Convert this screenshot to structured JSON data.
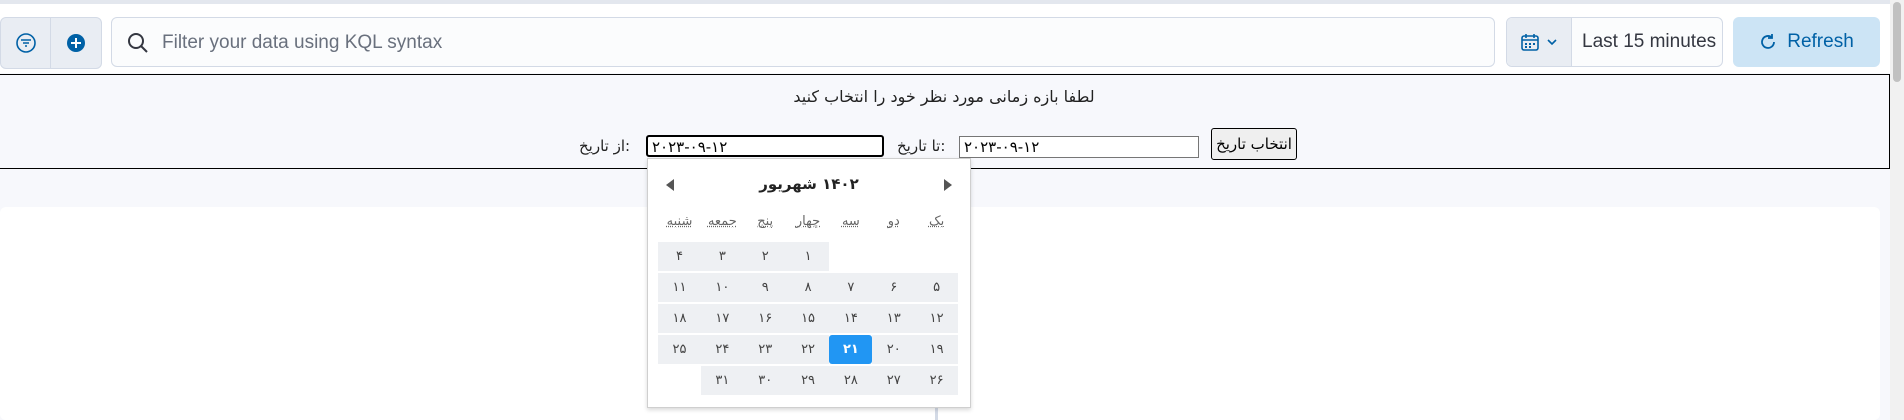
{
  "toolbar": {
    "filter_icon": "filter-icon",
    "add_icon": "plus-circle-icon",
    "search_placeholder": "Filter your data using KQL syntax",
    "time_range": "Last 15 minutes",
    "refresh_label": "Refresh"
  },
  "colors": {
    "accent": "#0061a6",
    "refresh_bg": "#cce4f5",
    "selected_day": "#2196f3"
  },
  "panel": {
    "title": "لطفا بازه زمانی مورد نظر خود را انتخاب کنید",
    "from_label": "از تاریخ:",
    "from_value": "۲۰۲۳-۰۹-۱۲",
    "to_label": "تا تاریخ:",
    "to_value": "۲۰۲۳-۰۹-۱۲",
    "submit": "انتخاب تاریخ"
  },
  "calendar": {
    "month_title": "۱۴۰۲ شهریور",
    "weekdays": [
      "یک",
      "دو",
      "سه",
      "چهار",
      "پنج",
      "جمعه",
      "شنبه"
    ],
    "weeks": [
      [
        "",
        "",
        "",
        "۱",
        "۲",
        "۳",
        "۴"
      ],
      [
        "۵",
        "۶",
        "۷",
        "۸",
        "۹",
        "۱۰",
        "۱۱"
      ],
      [
        "۱۲",
        "۱۳",
        "۱۴",
        "۱۵",
        "۱۶",
        "۱۷",
        "۱۸"
      ],
      [
        "۱۹",
        "۲۰",
        "۲۱",
        "۲۲",
        "۲۳",
        "۲۴",
        "۲۵"
      ],
      [
        "۲۶",
        "۲۷",
        "۲۸",
        "۲۹",
        "۳۰",
        "۳۱",
        ""
      ]
    ],
    "selected": "۲۱"
  }
}
